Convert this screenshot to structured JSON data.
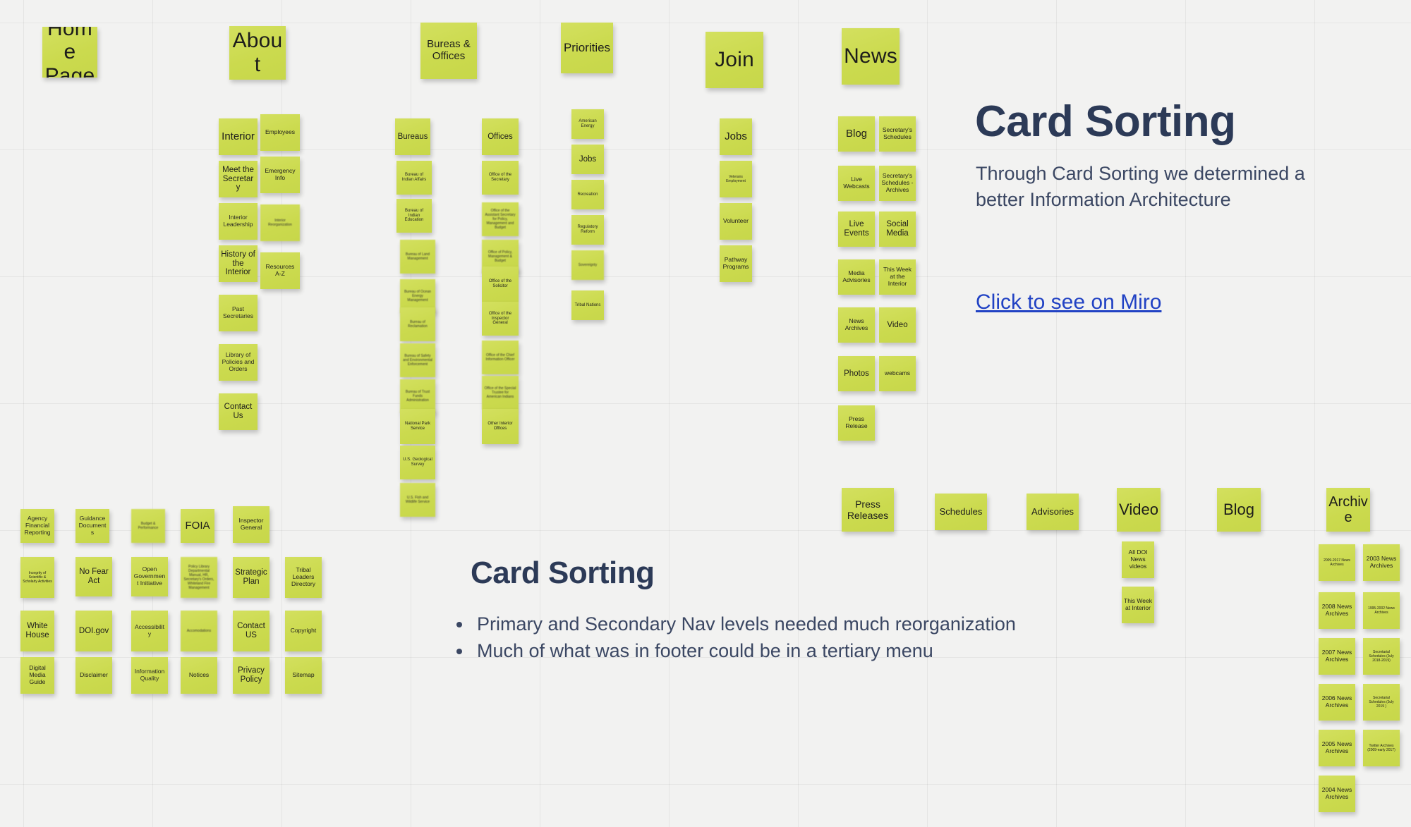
{
  "board": {
    "note_color": "#cddc53",
    "ink_color": "#2c3a57",
    "link_color": "#2142c4"
  },
  "panels": {
    "right": {
      "title": "Card Sorting",
      "body": "Through Card Sorting we determined a better Information Architecture",
      "link": "Click to see on Miro"
    },
    "bottom": {
      "title": "Card Sorting",
      "bullets": [
        "Primary and Secondary Nav levels needed much reorganization",
        "Much of what was in footer could be in a tertiary menu"
      ]
    }
  },
  "groups": {
    "home": {
      "header": "Home Page"
    },
    "about": {
      "header": "About",
      "col_left": [
        "Interior",
        "Meet the Secretary",
        "Interior Leadership",
        "History of the Interior",
        "Past Secretaries",
        "Library of Policies and Orders",
        "Contact Us"
      ],
      "col_right": [
        "Employees",
        "Emergency Info",
        "Interior Reorganization",
        "Resources A-Z"
      ]
    },
    "bureaus_offices": {
      "header": "Bureas & Offices",
      "bureaus_header": "Bureaus",
      "bureaus": [
        "Bureau of Indian Affairs",
        "Bureau of Indian Education",
        "Bureau of Land Management",
        "Bureau of Ocean Energy Management",
        "Bureau of Reclamation",
        "Bureau of Safety and Environmental Enforcement",
        "Bureau of Trust Funds Administration",
        "National Park Service",
        "U.S. Geological Survey",
        "U.S. Fish and Wildlife Service"
      ],
      "offices_header": "Offices",
      "offices": [
        "Office of the Secretary",
        "Office of the Assistant Secretary for Policy, Management and Budget",
        "Office of Policy, Management & Budget",
        "Office of the Solicitor",
        "Office of the Inspector General",
        "Office of the Chief Information Officer",
        "Office of the Special Trustee for American Indians",
        "Other Interior Offices"
      ]
    },
    "priorities": {
      "header": "Priorities",
      "items": [
        "American Energy",
        "Jobs",
        "Recreation",
        "Regulatory Reform",
        "Sovereignty",
        "Tribal Nations"
      ]
    },
    "join": {
      "header": "Join",
      "items": [
        "Jobs",
        "Veterans Employment",
        "Volunteer",
        "Pathway Programs"
      ]
    },
    "news": {
      "header": "News",
      "col_left": [
        "Blog",
        "Live Webcasts",
        "Live Events",
        "Media Advisories",
        "News Archives",
        "Photos",
        "Press Release"
      ],
      "col_right": [
        "Secretary's Schedules",
        "Secretary's Schedules - Archives",
        "Social Media",
        "This Week at the Interior",
        "Video",
        "webcams"
      ]
    },
    "footer_cards": {
      "rows": [
        [
          "Agency Financial Reporting",
          "Guidance Documents",
          "Budget & Performance",
          "FOIA",
          "Inspector General"
        ],
        [
          "Incegrity of Scientific & Scholarly Activities",
          "No Fear Act",
          "Open Government Initiative",
          "Policy Library Departmental Manual, HR, Secretary's Orders, Whiteland Fire Management",
          "Strategic Plan",
          "Tribal Leaders Directory"
        ],
        [
          "White House",
          "DOI.gov",
          "Accessibility",
          "Accomodations",
          "Contact US",
          "Copyright"
        ],
        [
          "Digital Media Guide",
          "Disclaimer",
          "Information Quality",
          "Notices",
          "Privacy Policy",
          "Sitemap"
        ]
      ]
    },
    "news_row": {
      "items": [
        "Press Releases",
        "Schedules",
        "Advisories",
        "Video",
        "Blog",
        "Archive"
      ],
      "video_children": [
        "All DOI News videos",
        "This Week at Interior"
      ]
    },
    "archive": {
      "header": "Archive",
      "col_left": [
        "2009-2017 News Archives",
        "2008 News Archives",
        "2007 News Archives",
        "2006 News Archives",
        "2005 News Archives",
        "2004 News Archives"
      ],
      "col_right": [
        "2003 News Archives",
        "1995-2002 News Archives",
        "Secretarial Schedules (July 2018-2019)",
        "Secretarial Schedules (July 2019 )",
        "Twitter Archives (2009-early 2017)"
      ]
    }
  }
}
